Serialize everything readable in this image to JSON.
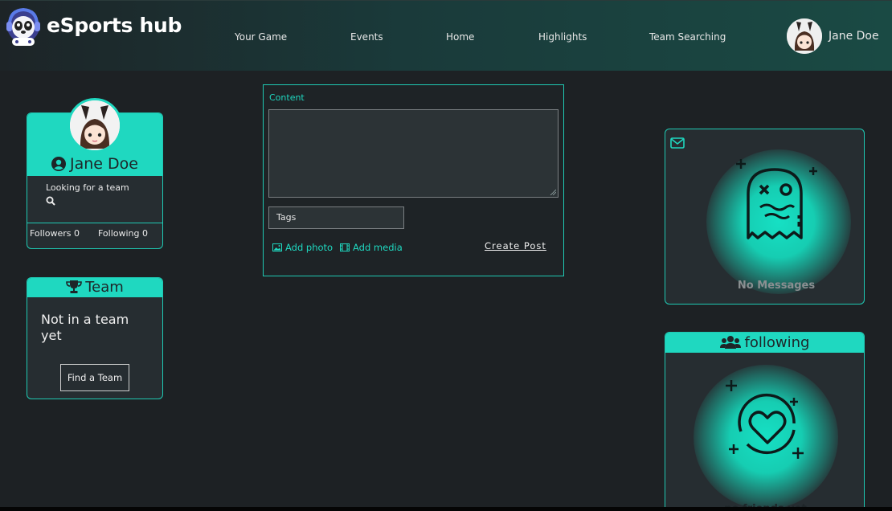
{
  "header": {
    "brand": "eSports hub",
    "nav": [
      "Your Game",
      "Events",
      "Home",
      "Highlights",
      "Team Searching"
    ],
    "user_name": "Jane Doe"
  },
  "profile": {
    "name": "Jane Doe",
    "status": "Looking for a team",
    "followers_label": "Followers 0",
    "following_label": "Following 0"
  },
  "team": {
    "title": "Team",
    "status": "Not in a team yet",
    "button": "Find a Team"
  },
  "post": {
    "content_label": "Content",
    "tags_placeholder": "Tags",
    "add_photo": "Add photo",
    "add_media": "Add media",
    "create_post": "Create Post"
  },
  "messages": {
    "empty_text": "No Messages"
  },
  "following": {
    "title": "following",
    "empty_text": "no friends yet"
  },
  "colors": {
    "accent": "#1fd8c0",
    "background": "#1d2124",
    "card": "#262d31"
  }
}
